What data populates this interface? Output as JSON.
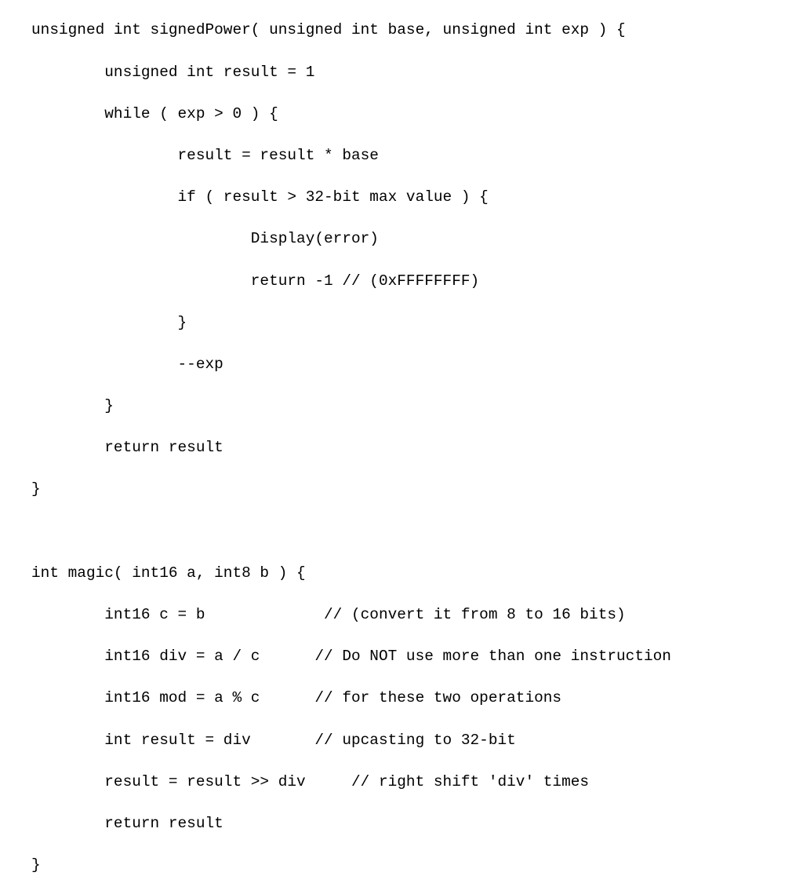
{
  "document": {
    "kind": "source-code-listing",
    "language": "c-like-pseudocode",
    "background_color": "#ffffff",
    "text_color": "#000000",
    "font_style": "monospace",
    "indent_unit_spaces": 8
  },
  "listing": {
    "lines": [
      "unsigned int signedPower( unsigned int base, unsigned int exp ) {",
      "        unsigned int result = 1",
      "        while ( exp > 0 ) {",
      "                result = result * base",
      "                if ( result > 32-bit max value ) {",
      "                        Display(error)",
      "                        return -1 // (0xFFFFFFFF)",
      "                }",
      "                --exp",
      "        }",
      "        return result",
      "}",
      "",
      "int magic( int16 a, int8 b ) {",
      "        int16 c = b             // (convert it from 8 to 16 bits)",
      "        int16 div = a / c      // Do NOT use more than one instruction",
      "        int16 mod = a % c      // for these two operations",
      "        int result = div       // upcasting to 32-bit",
      "        result = result >> div     // right shift 'div' times",
      "        return result",
      "}"
    ]
  },
  "functions": [
    {
      "name": "signedPower",
      "return_type": "unsigned int",
      "parameters": [
        {
          "type": "unsigned int",
          "name": "base"
        },
        {
          "type": "unsigned int",
          "name": "exp"
        }
      ],
      "body_statements": [
        "unsigned int result = 1",
        "while ( exp > 0 ) {",
        "result = result * base",
        "if ( result > 32-bit max value ) {",
        "Display(error)",
        "return -1",
        "--exp",
        "return result"
      ],
      "comments": [
        {
          "text": "// (0xFFFFFFFF)",
          "attached_to": "return -1"
        }
      ],
      "literals": [
        "1",
        "0",
        "-1",
        "0xFFFFFFFF",
        "32-bit"
      ]
    },
    {
      "name": "magic",
      "return_type": "int",
      "parameters": [
        {
          "type": "int16",
          "name": "a"
        },
        {
          "type": "int8",
          "name": "b"
        }
      ],
      "body_statements": [
        "int16 c = b",
        "int16 div = a / c",
        "int16 mod = a % c",
        "int result = div",
        "result = result >> div",
        "return result"
      ],
      "comments": [
        {
          "text": "// (convert it from 8 to 16 bits)",
          "attached_to": "int16 c = b"
        },
        {
          "text": "// Do NOT use more than one instruction",
          "attached_to": "int16 div = a / c"
        },
        {
          "text": "// for these two operations",
          "attached_to": "int16 mod = a % c"
        },
        {
          "text": "// upcasting to 32-bit",
          "attached_to": "int result = div"
        },
        {
          "text": "// right shift 'div' times",
          "attached_to": "result = result >> div"
        }
      ],
      "literals": [
        "8",
        "16",
        "32-bit"
      ]
    }
  ]
}
